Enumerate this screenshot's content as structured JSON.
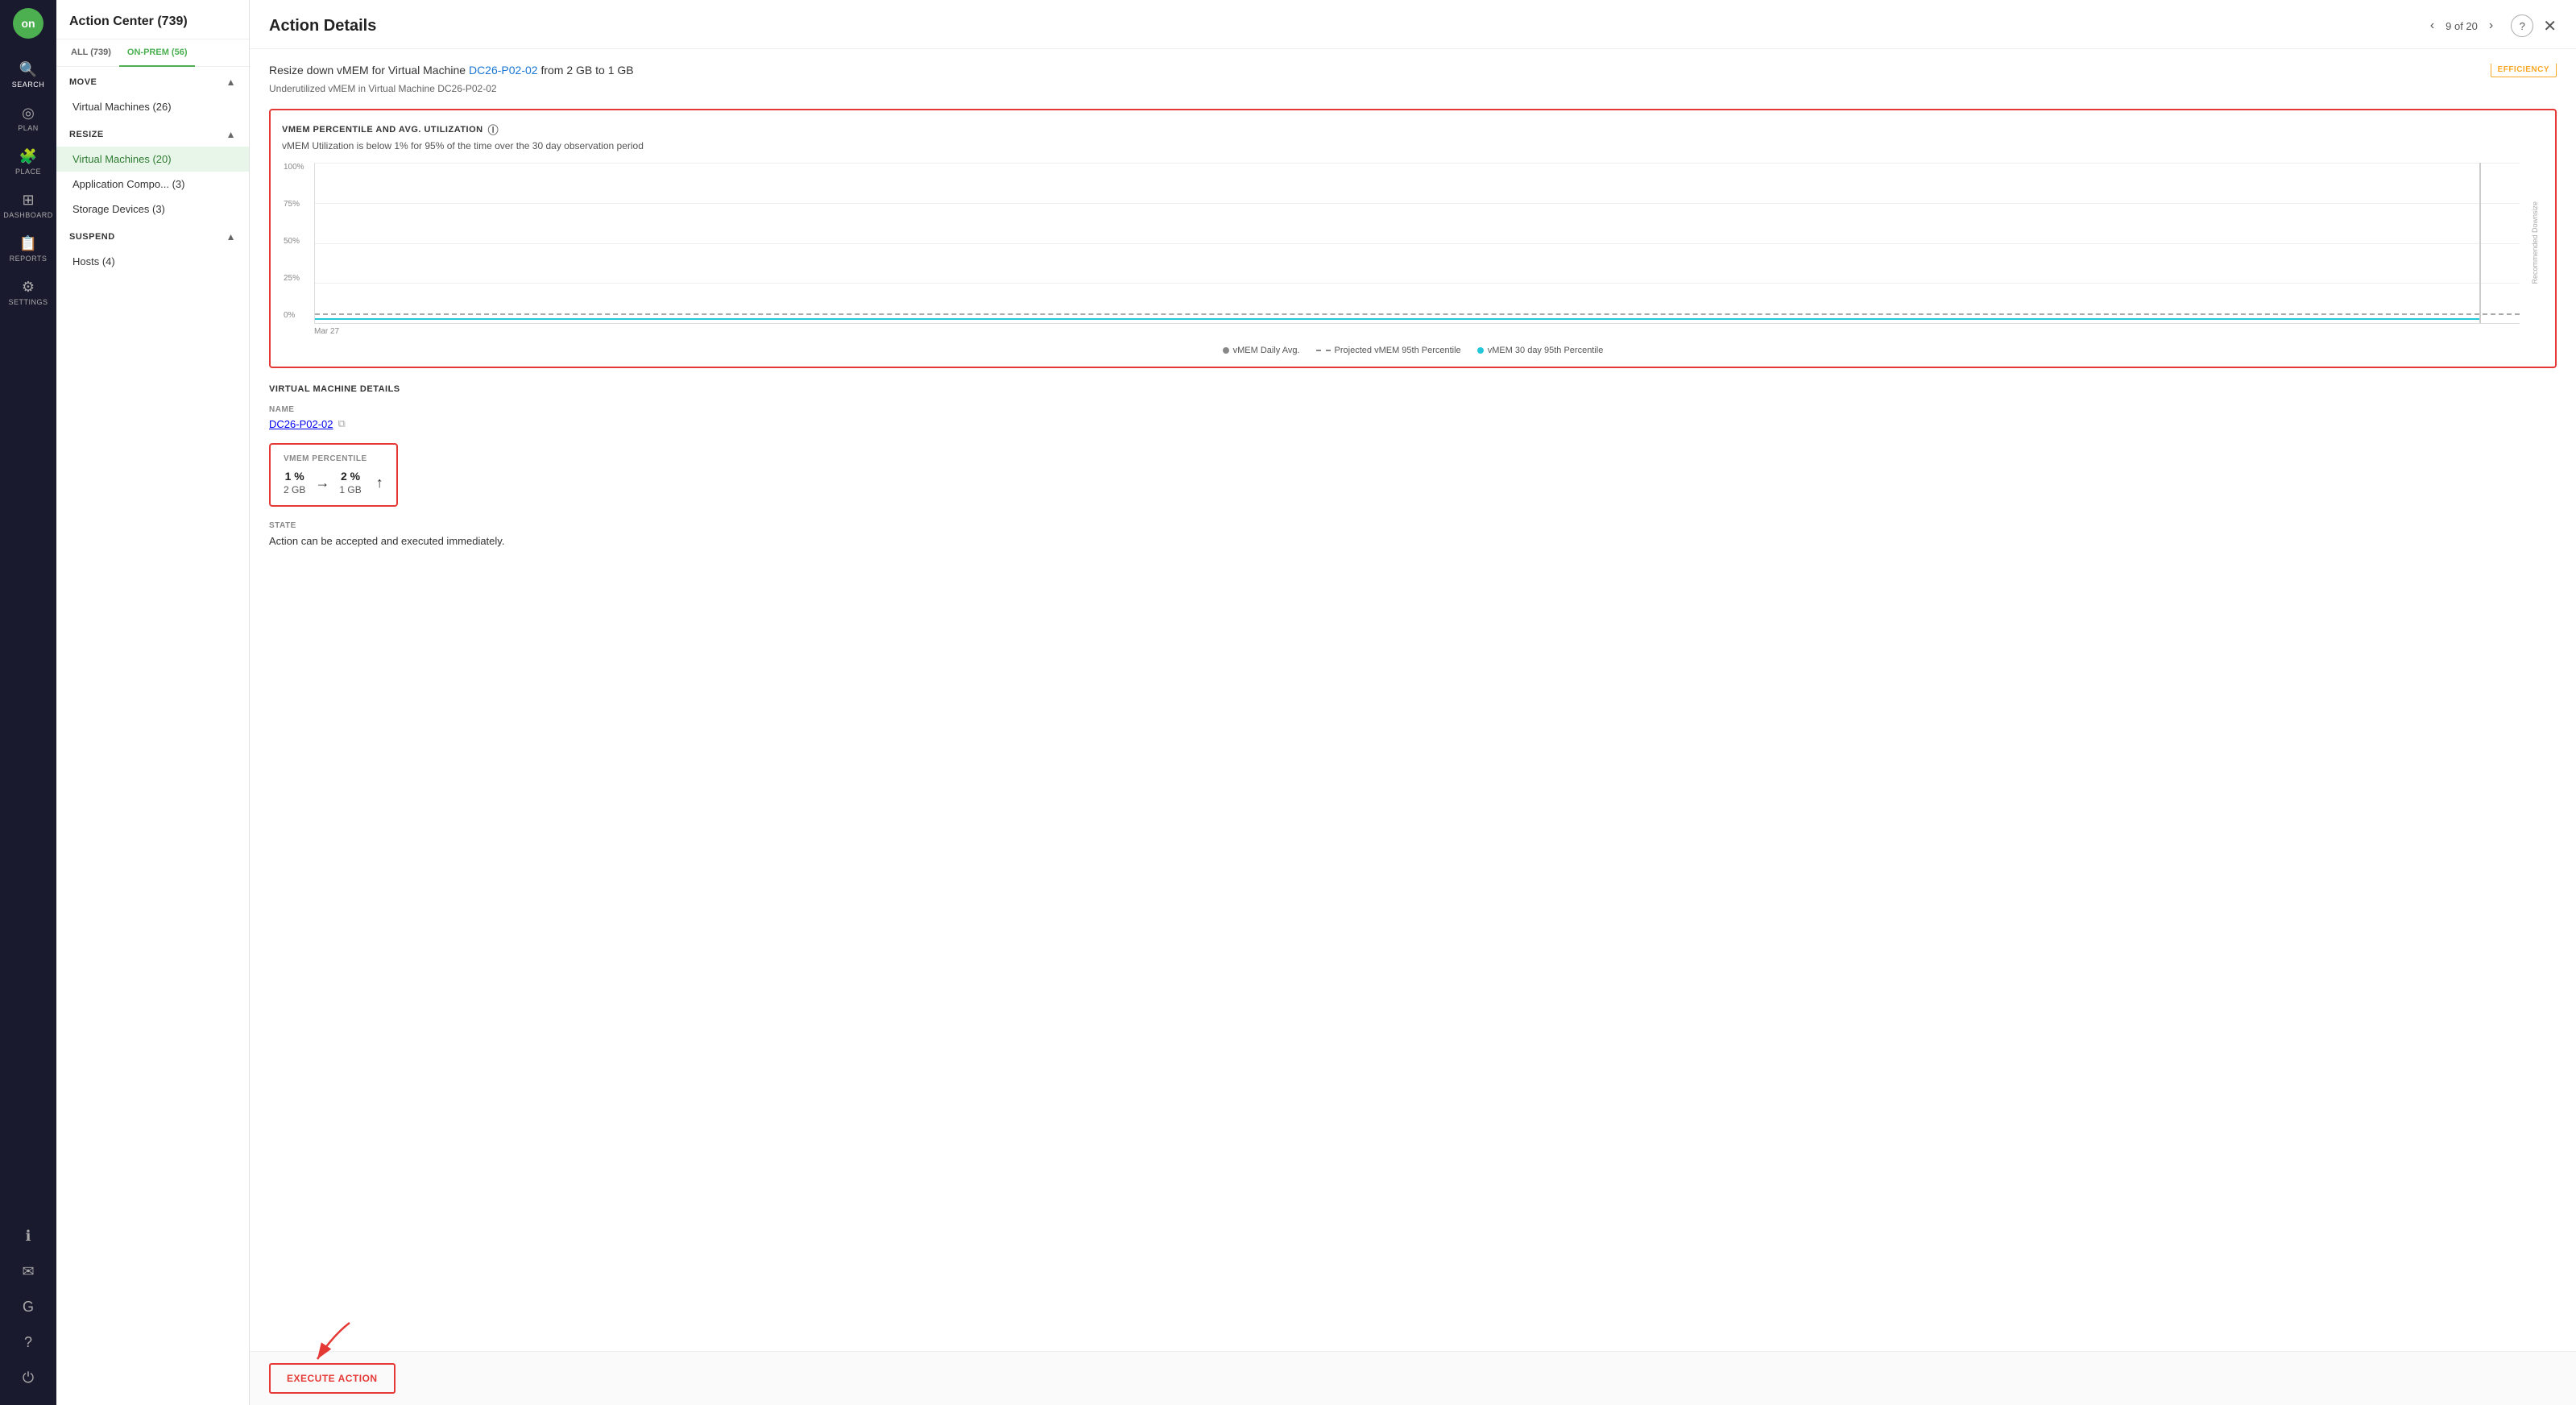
{
  "app": {
    "logo_text": "on",
    "nav_items": [
      {
        "id": "search",
        "icon": "🔍",
        "label": "SEARCH"
      },
      {
        "id": "plan",
        "icon": "◎",
        "label": "PLAN"
      },
      {
        "id": "place",
        "icon": "🧩",
        "label": "PLACE"
      },
      {
        "id": "dashboard",
        "icon": "⊞",
        "label": "DASHBOARD"
      },
      {
        "id": "reports",
        "icon": "📋",
        "label": "REPORTS"
      },
      {
        "id": "settings",
        "icon": "⚙",
        "label": "SETTINGS"
      }
    ],
    "nav_bottom_items": [
      {
        "id": "info",
        "icon": "ℹ"
      },
      {
        "id": "mail",
        "icon": "✉"
      },
      {
        "id": "g",
        "icon": "G"
      },
      {
        "id": "help",
        "icon": "?"
      },
      {
        "id": "power",
        "icon": "⏻"
      }
    ]
  },
  "sidebar": {
    "title": "Action Center (739)",
    "tabs": [
      {
        "id": "all",
        "label": "ALL (739)",
        "active": false
      },
      {
        "id": "on_prem",
        "label": "ON-PREM (56)",
        "active": true
      }
    ],
    "sections": [
      {
        "id": "move",
        "label": "MOVE",
        "expanded": true,
        "items": [
          {
            "id": "vms",
            "label": "Virtual Machines (26)"
          }
        ]
      },
      {
        "id": "resize",
        "label": "RESIZE",
        "expanded": true,
        "items": [
          {
            "id": "vms_resize",
            "label": "Virtual Machines (20)",
            "active": true
          },
          {
            "id": "app_compo",
            "label": "Application Compo... (3)"
          },
          {
            "id": "storage",
            "label": "Storage Devices (3)"
          }
        ]
      },
      {
        "id": "suspend",
        "label": "SUSPEND",
        "expanded": true,
        "items": [
          {
            "id": "hosts",
            "label": "Hosts (4)"
          }
        ]
      }
    ]
  },
  "panel": {
    "title": "Action Details",
    "nav_counter": "9 of 20",
    "action_title_prefix": "Resize down vMEM for Virtual Machine ",
    "action_title_link": "DC26-P02-02",
    "action_title_suffix": " from 2 GB to 1 GB",
    "action_subtitle": "Underutilized vMEM in Virtual Machine DC26-P02-02",
    "efficiency_badge": "EFFICIENCY",
    "chart": {
      "title": "VMEM PERCENTILE AND AVG. UTILIZATION",
      "description": "vMEM Utilization is below 1% for 95% of the time over the 30 day observation period",
      "y_labels": [
        "100%",
        "75%",
        "50%",
        "25%",
        "0%"
      ],
      "x_label": "Mar 27",
      "legend": [
        {
          "id": "daily_avg",
          "type": "dot",
          "color": "#888",
          "label": "vMEM Daily Avg."
        },
        {
          "id": "projected",
          "type": "dash",
          "color": "#888",
          "label": "Projected vMEM 95th Percentile"
        },
        {
          "id": "percentile",
          "type": "dot",
          "color": "#26c6da",
          "label": "vMEM 30 day 95th Percentile"
        }
      ],
      "downsize_label": "Recommended Downsize"
    },
    "vm_details": {
      "section_title": "VIRTUAL MACHINE DETAILS",
      "name_label": "NAME",
      "name_value": "DC26-P02-02",
      "vmem_label": "VMEM PERCENTILE",
      "vmem_from_pct": "1 %",
      "vmem_to_pct": "2 %",
      "vmem_from_gb": "2 GB",
      "vmem_to_gb": "1 GB",
      "state_label": "STATE",
      "state_value": "Action can be accepted and executed immediately."
    },
    "footer": {
      "execute_btn": "EXECUTE ACTION"
    }
  }
}
